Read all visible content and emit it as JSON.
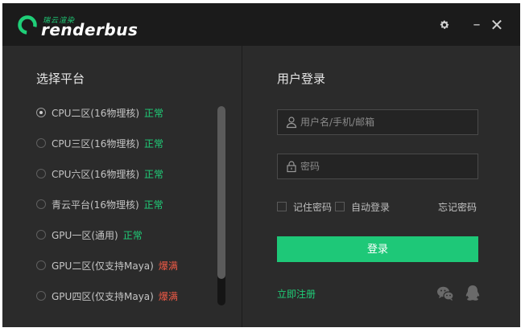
{
  "app": {
    "logo_subtitle": "瑞云渲染",
    "logo_name": "renderbus"
  },
  "window_controls": {
    "minimize": "–",
    "close": "✕"
  },
  "platform": {
    "title": "选择平台",
    "items": [
      {
        "name": "CPU二区(16物理核)",
        "status": "正常",
        "selected": true
      },
      {
        "name": "CPU三区(16物理核)",
        "status": "正常",
        "selected": false
      },
      {
        "name": "CPU六区(16物理核)",
        "status": "正常",
        "selected": false
      },
      {
        "name": "青云平台(16物理核)",
        "status": "正常",
        "selected": false
      },
      {
        "name": "GPU一区(通用)",
        "status": "正常",
        "selected": false
      },
      {
        "name": "GPU二区(仅支持Maya)",
        "status": "爆满",
        "selected": false
      },
      {
        "name": "GPU四区(仅支持Maya)",
        "status": "爆满",
        "selected": false
      }
    ]
  },
  "login": {
    "title": "用户登录",
    "username_placeholder": "用户名/手机/邮箱",
    "password_placeholder": "密码",
    "remember_password": "记住密码",
    "auto_login": "自动登录",
    "forgot_password": "忘记密码",
    "login_button": "登录",
    "register": "立即注册"
  },
  "colors": {
    "accent": "#1ec878",
    "status_normal": "#1fcf78",
    "status_full": "#f05a46",
    "background": "#2b2b2b",
    "titlebar": "#1b1b1b"
  },
  "icons": {
    "settings": "gear-icon",
    "username": "user-icon",
    "password": "lock-icon",
    "wechat": "wechat-icon",
    "qq": "qq-icon"
  }
}
